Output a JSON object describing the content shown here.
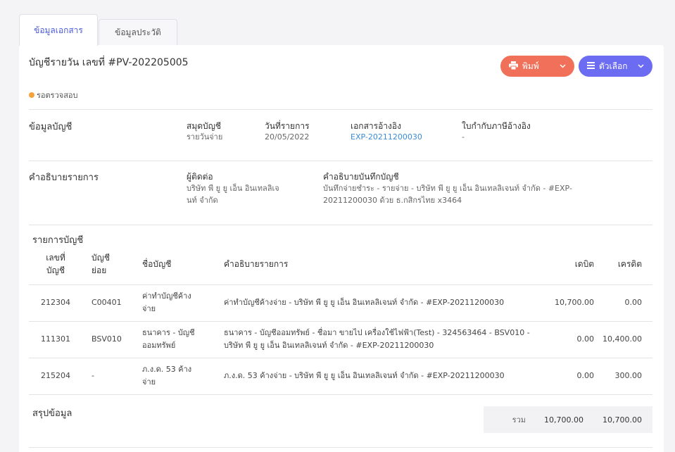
{
  "tabs": [
    {
      "label": "ข้อมูลเอกสาร",
      "active": true
    },
    {
      "label": "ข้อมูลประวัติ",
      "active": false
    }
  ],
  "document": {
    "title": "บัญชีรายวัน เลขที่ #PV-202205005",
    "status": "รอตรวจสอบ"
  },
  "actions": {
    "print_label": "พิมพ์",
    "options_label": "ตัวเลือก"
  },
  "account_info": {
    "section_title": "ข้อมูลบัญชี",
    "journal_label": "สมุดบัญชี",
    "journal_value": "รายวันจ่าย",
    "date_label": "วันที่รายการ",
    "date_value": "20/05/2022",
    "ref_label": "เอกสารอ้างอิง",
    "ref_value": "EXP-20211200030",
    "tax_label": "ใบกำกับภาษีอ้างอิง",
    "tax_value": "-"
  },
  "description": {
    "section_title": "คำอธิบายรายการ",
    "contact_label": "ผู้ติดต่อ",
    "contact_value_line1": "บริษัท พี ยู ยู เอ็น อินเทลลิเจ",
    "contact_value_line2": "นท์ จำกัด",
    "memo_label": "คำอธิบายบันทึกบัญชี",
    "memo_value_line1": "บันทึกจ่ายชำระ - รายจ่าย - บริษัท พี ยู ยู เอ็น อินเทลลิเจนท์ จำกัด - #EXP-",
    "memo_value_line2": "20211200030 ด้วย ธ.กสิกรไทย x3464"
  },
  "lines": {
    "section_title": "รายการบัญชี",
    "headers": {
      "no_line1": "เลขที่",
      "no_line2": "บัญชี",
      "sub_line1": "บัญชี",
      "sub_line2": "ย่อย",
      "name": "ชื่อบัญชี",
      "desc": "คำอธิบายรายการ",
      "debit": "เดบิต",
      "credit": "เครดิต"
    },
    "rows": [
      {
        "no": "212304",
        "sub": "C00401",
        "name1": "ค่าทำบัญชีค้าง",
        "name2": "จ่าย",
        "desc1": "ค่าทำบัญชีค้างจ่าย - บริษัท พี ยู ยู เอ็น อินเทลลิเจนท์ จำกัด - #EXP-20211200030",
        "desc2": "",
        "debit": "10,700.00",
        "credit": "0.00"
      },
      {
        "no": "111301",
        "sub": "BSV010",
        "name1": "ธนาคาร - บัญชี",
        "name2": "ออมทรัพย์",
        "desc1": "ธนาคาร - บัญชีออมทรัพย์ - ชื่อมา ขายไป เครื่องใช้ไฟฟ้า(Test) - 324563464 - BSV010 -",
        "desc2": "บริษัท พี ยู ยู เอ็น อินเทลลิเจนท์ จำกัด - #EXP-20211200030",
        "debit": "0.00",
        "credit": "10,400.00"
      },
      {
        "no": "215204",
        "sub": "-",
        "name1": "ภ.ง.ด. 53 ค้าง",
        "name2": "จ่าย",
        "desc1": "ภ.ง.ด. 53 ค้างจ่าย - บริษัท พี ยู ยู เอ็น อินเทลลิเจนท์ จำกัด - #EXP-20211200030",
        "desc2": "",
        "debit": "0.00",
        "credit": "300.00"
      }
    ]
  },
  "summary": {
    "section_title": "สรุปข้อมูล",
    "total_label": "รวม",
    "total_debit": "10,700.00",
    "total_credit": "10,700.00"
  },
  "colors": {
    "primary": "#4b5bd8",
    "print_button": "#f07059",
    "options_button": "#6c6cf2",
    "status_pending": "#f6a23c",
    "link": "#3a8bd8"
  },
  "icons": {
    "print": "printer-icon",
    "options": "menu-icon",
    "chevron": "chevron-down-icon"
  }
}
